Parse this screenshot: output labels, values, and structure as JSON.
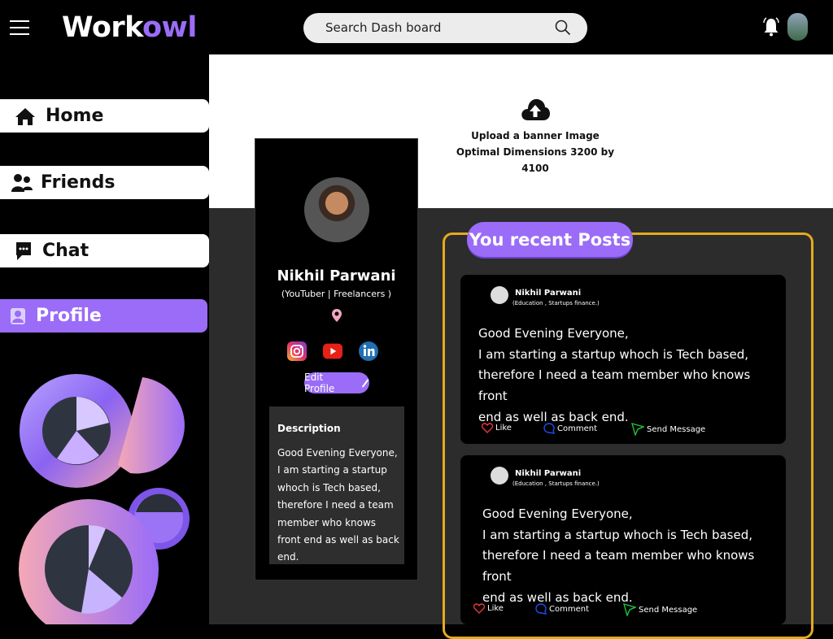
{
  "app": {
    "logo_part1": "Work",
    "logo_part2": "owl"
  },
  "search": {
    "placeholder": "Search Dash board"
  },
  "colors": {
    "accent": "#9b6cf7",
    "gold": "#e5aa1c",
    "background": "#000000",
    "panel": "#2c2c2c"
  },
  "sidebar": {
    "items": [
      {
        "label": "Home",
        "icon": "home-icon"
      },
      {
        "label": "Friends",
        "icon": "friends-icon"
      },
      {
        "label": "Chat",
        "icon": "chat-icon"
      },
      {
        "label": "Profile",
        "icon": "profile-icon",
        "active": true
      }
    ]
  },
  "banner": {
    "line1": "Upload a banner Image",
    "line2": "Optimal Dimensions 3200 by 4100"
  },
  "profile": {
    "name": "Nikhil Parwani",
    "title": "(YouTuber | Freelancers )",
    "edit_label": "Edit Profile",
    "description_heading": "Description",
    "description": "Good Evening Everyone, I am starting a startup whoch is Tech based, therefore I need a team member who knows front end as well as back end."
  },
  "posts": {
    "title": "You recent Posts",
    "items": [
      {
        "user": "Nikhil Parwani",
        "sub": "(Education , Startups finance.)",
        "text_lines": [
          "Good Evening Everyone,",
          "I am starting a startup whoch is Tech based,",
          "therefore I need a team member who knows front",
          "end as well as back end."
        ]
      },
      {
        "user": "Nikhil Parwani",
        "sub": "(Education , Startups finance.)",
        "text_lines": [
          "Good Evening Everyone,",
          "I am starting a startup whoch is Tech based,",
          "therefore I need a team member who knows front",
          "end as well as back end."
        ]
      }
    ],
    "actions": {
      "like": "Like",
      "comment": "Comment",
      "send": "Send Message"
    }
  }
}
